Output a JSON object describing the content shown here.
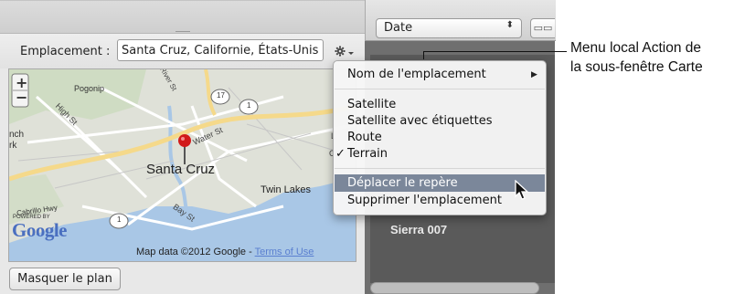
{
  "location": {
    "label": "Emplacement :",
    "value": "Santa Cruz, Californie, États-Unis",
    "action_icon": "gear-icon"
  },
  "map": {
    "place_labels": [
      "Santa Cruz",
      "Twin Lakes",
      "Pogonip"
    ],
    "street_labels": [
      "High St",
      "Water St",
      "Bay St",
      "Cabrillo Hwy",
      "River St",
      "Ca",
      "L"
    ],
    "route_numbers": [
      "1",
      "17",
      "1"
    ],
    "partial_labels": [
      "nch",
      "rk"
    ],
    "zoom_in": "+",
    "zoom_out": "−",
    "google_logo": "Google",
    "powered_by": "POWERED BY",
    "attribution": "Map data ©2012 Google - ",
    "terms_link": "Terms of Use",
    "colors": {
      "water": "#a9c7e6",
      "roads": "#ffffff",
      "highway": "#f5d98a",
      "pin": "#d11a1a"
    }
  },
  "buttons": {
    "hide_map": "Masquer le plan"
  },
  "browser": {
    "sort_value": "Date",
    "sort_arrows": "⬍",
    "view_icon": "▭▭",
    "item_name": "Sierra 007"
  },
  "menu": {
    "items": [
      {
        "label": "Nom de l'emplacement",
        "submenu_arrow": "▶"
      },
      {
        "label": "Satellite"
      },
      {
        "label": "Satellite avec étiquettes"
      },
      {
        "label": "Route"
      },
      {
        "label": "Terrain",
        "checkmark": "✓"
      },
      {
        "label": "Déplacer le repère",
        "highlighted": true
      },
      {
        "label": "Supprimer l'emplacement"
      }
    ],
    "highlight_color": "#7b879a"
  },
  "callout": {
    "line1": "Menu local Action de",
    "line2": "la sous-fenêtre Carte"
  }
}
